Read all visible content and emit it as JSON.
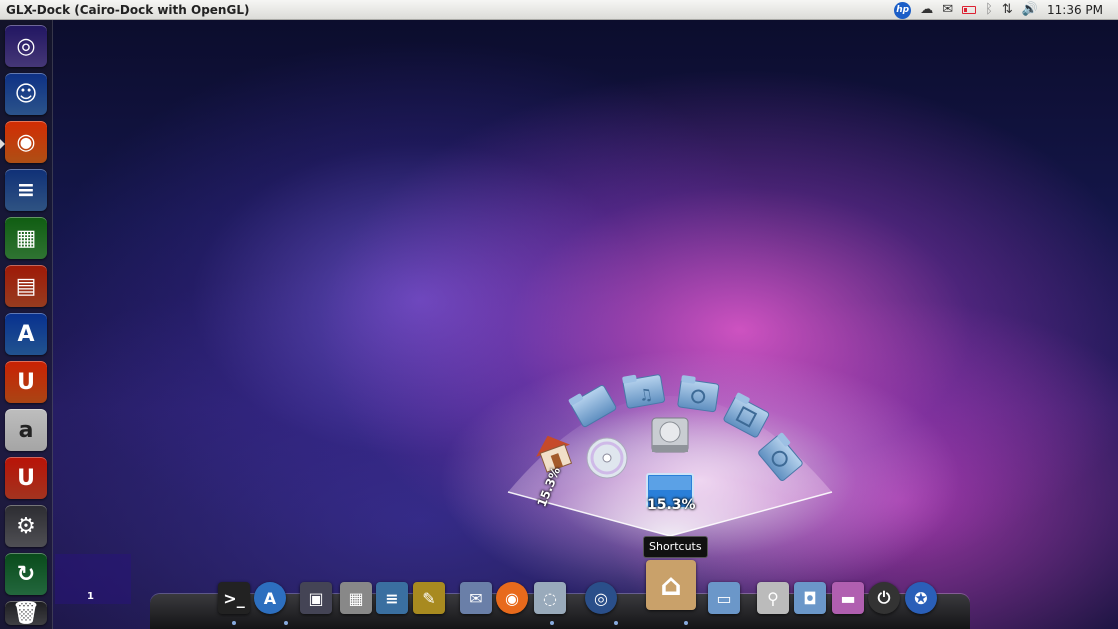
{
  "panel": {
    "window_title": "GLX-Dock (Cairo-Dock with OpenGL)",
    "tray_icons": [
      "hp-icon",
      "cloud-icon",
      "mail-icon",
      "battery-icon",
      "bluetooth-icon",
      "network-icon",
      "volume-icon"
    ],
    "hp_label": "hp",
    "clock": "11:36 PM"
  },
  "launcher": {
    "items": [
      {
        "name": "ubuntu-icon",
        "color": "#5c4a9e"
      },
      {
        "name": "finder-icon",
        "color": "#3a6fb8"
      },
      {
        "name": "firefox-icon",
        "color": "#e86a1c"
      },
      {
        "name": "writer-icon",
        "color": "#3f6fae"
      },
      {
        "name": "calc-icon",
        "color": "#3f9a43"
      },
      {
        "name": "impress-icon",
        "color": "#c9502a"
      },
      {
        "name": "app-store-icon",
        "color": "#2d6fbf"
      },
      {
        "name": "ubuntu-one-icon",
        "color": "#e35c1b"
      },
      {
        "name": "amazon-icon",
        "color": "#dcdcdc"
      },
      {
        "name": "ubuntu-one-music-icon",
        "color": "#d9452a"
      },
      {
        "name": "system-settings-icon",
        "color": "#6a6a70"
      },
      {
        "name": "update-manager-icon",
        "color": "#2f8a52"
      },
      {
        "name": "trash-icon",
        "color": "#55555a"
      }
    ]
  },
  "workspace": {
    "number": "1"
  },
  "fan": {
    "items": [
      "documents-folder-icon",
      "music-folder-icon",
      "pictures-folder-icon",
      "videos-folder-icon",
      "downloads-folder-icon"
    ],
    "home_percent": "15.3%",
    "screen_percent": "15.3%"
  },
  "tooltip": "Shortcuts",
  "dock": {
    "items": [
      {
        "name": "terminal-icon",
        "glyph": ">_",
        "color": "#222"
      },
      {
        "name": "app-store-icon",
        "glyph": "A",
        "color": "#2d6fbf"
      },
      {
        "name": "photos-icon",
        "glyph": "▣",
        "color": "#445"
      },
      {
        "name": "calculator-icon",
        "glyph": "▦",
        "color": "#888"
      },
      {
        "name": "text-editor-icon",
        "glyph": "≡",
        "color": "#3a6fa0"
      },
      {
        "name": "gimp-icon",
        "glyph": "✎",
        "color": "#a88a20"
      },
      {
        "name": "mail-stamp-icon",
        "glyph": "✉",
        "color": "#6a7fa8"
      },
      {
        "name": "firefox-icon",
        "glyph": "◉",
        "color": "#e86a1c"
      },
      {
        "name": "chat-icon",
        "glyph": "◌",
        "color": "#9ab"
      },
      {
        "name": "network-globe-icon",
        "glyph": "◎",
        "color": "#2a4f8a"
      },
      {
        "name": "home-folder-icon",
        "glyph": "⌂",
        "color": "#c9a16a"
      },
      {
        "name": "folder-icon",
        "glyph": "▭",
        "color": "#6b97c9"
      },
      {
        "name": "search-icon",
        "glyph": "⚲",
        "color": "#bbb"
      },
      {
        "name": "screenshot-icon",
        "glyph": "◘",
        "color": "#6b97c9"
      },
      {
        "name": "desktop-icon",
        "glyph": "▬",
        "color": "#b05fb0"
      },
      {
        "name": "power-icon",
        "glyph": "⏻",
        "color": "#333"
      },
      {
        "name": "accessibility-icon",
        "glyph": "✪",
        "color": "#2a5fb8"
      }
    ]
  }
}
